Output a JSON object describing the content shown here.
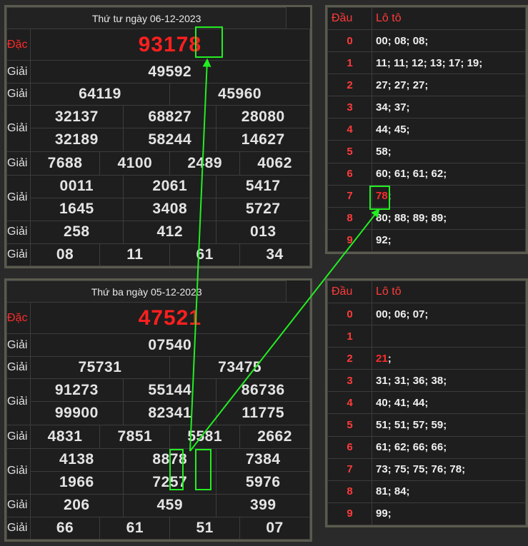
{
  "top": {
    "title": "Thứ tư ngày 06-12-2023",
    "labels": {
      "db": "Đặc biệt",
      "g1": "Giải nhất",
      "g2": "Giải nhì",
      "g3": "Giải ba",
      "g4": "Giải tư",
      "g5": "Giải năm",
      "g6": "Giải sáu",
      "g7": "Giải bảy"
    },
    "db": "93178",
    "g1": "49592",
    "g2": [
      "64119",
      "45960"
    ],
    "g3": [
      "32137",
      "68827",
      "28080",
      "32189",
      "58244",
      "14627"
    ],
    "g4": [
      "7688",
      "4100",
      "2489",
      "4062"
    ],
    "g5": [
      "0011",
      "2061",
      "5417",
      "1645",
      "3408",
      "5727"
    ],
    "g6": [
      "258",
      "412",
      "013"
    ],
    "g7": [
      "08",
      "11",
      "61",
      "34"
    ]
  },
  "bottom": {
    "title": "Thứ ba ngày 05-12-2023",
    "labels": {
      "db": "Đặc biệt",
      "g1": "Giải nhất",
      "g2": "Giải nhì",
      "g3": "Giải ba",
      "g4": "Giải tư",
      "g5": "Giải năm",
      "g6": "Giải sáu",
      "g7": "Giải bảy"
    },
    "db": "47521",
    "g1": "07540",
    "g2": [
      "75731",
      "73475"
    ],
    "g3": [
      "91273",
      "55144",
      "86736",
      "99900",
      "82341",
      "11775"
    ],
    "g4": [
      "4831",
      "7851",
      "5581",
      "2662"
    ],
    "g5": [
      "4138",
      "8878",
      "7384",
      "1966",
      "7257",
      "5976"
    ],
    "g6": [
      "206",
      "459",
      "399"
    ],
    "g7": [
      "66",
      "61",
      "51",
      "07"
    ]
  },
  "loto_top": {
    "head": "Đầu",
    "tail": "Lô tô",
    "rows": [
      {
        "d": "0",
        "v": "00; 08; 08;"
      },
      {
        "d": "1",
        "v": "11; 11; 12; 13; 17; 19;"
      },
      {
        "d": "2",
        "v": "27; 27; 27;"
      },
      {
        "d": "3",
        "v": "34; 37;"
      },
      {
        "d": "4",
        "v": "44; 45;"
      },
      {
        "d": "5",
        "v": "58;"
      },
      {
        "d": "6",
        "v": "60; 61; 61; 62;"
      },
      {
        "d": "7",
        "hi": "78",
        "v": ";"
      },
      {
        "d": "8",
        "v": "80; 88; 89; 89;"
      },
      {
        "d": "9",
        "v": "92;"
      }
    ]
  },
  "loto_bottom": {
    "head": "Đầu",
    "tail": "Lô tô",
    "rows": [
      {
        "d": "0",
        "v": "00; 06; 07;"
      },
      {
        "d": "1",
        "v": ""
      },
      {
        "d": "2",
        "hi": "21",
        "v": ";"
      },
      {
        "d": "3",
        "v": "31; 31; 36; 38;"
      },
      {
        "d": "4",
        "v": "40; 41; 44;"
      },
      {
        "d": "5",
        "v": "51; 51; 57; 59;"
      },
      {
        "d": "6",
        "v": "61; 62; 66; 66;"
      },
      {
        "d": "7",
        "v": "73; 75; 75; 76; 78;"
      },
      {
        "d": "8",
        "v": "81; 84;"
      },
      {
        "d": "9",
        "v": "99;"
      }
    ]
  },
  "colors": {
    "highlight": "#22ee22",
    "special": "#ff1f1f"
  }
}
